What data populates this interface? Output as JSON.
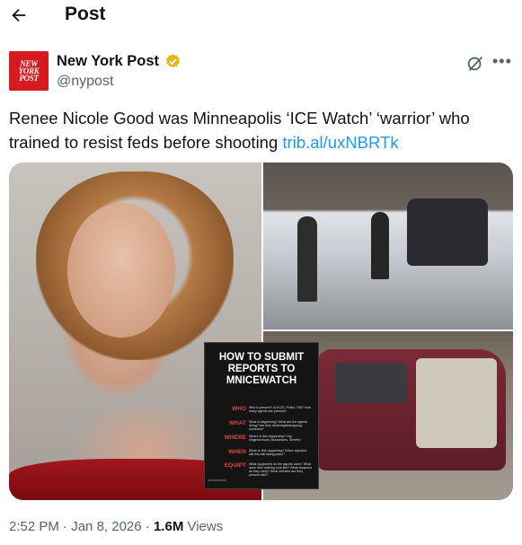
{
  "header": {
    "title": "Post"
  },
  "author": {
    "display_name": "New York Post",
    "handle": "@nypost",
    "avatar_lines": [
      "NEW",
      "YORK",
      "POST"
    ]
  },
  "post": {
    "text": "Renee Nicole Good was Minneapolis ‘ICE Watch’ ‘warrior’ who trained to resist feds before shooting",
    "link": "trib.al/uxNBRTk"
  },
  "media": {
    "card": {
      "title_lines": [
        "HOW TO SUBMIT",
        "REPORTS TO",
        "MNICEWATCH"
      ],
      "rows": [
        {
          "key": "WHO",
          "text": "Who is present? Is it ICE, Police, FBI? How many agents are present?"
        },
        {
          "key": "WHAT",
          "text": "What is happening? What are the agents doing? Are they detaining/kidnapping someone?"
        },
        {
          "key": "WHERE",
          "text": "Where is this happening? City, Neighborhood, Businesses, Streets?"
        },
        {
          "key": "WHEN",
          "text": "When is this happening? When reported, still this still taking place?"
        },
        {
          "key": "EQUIPT",
          "text": "What equipment do the agents have? What does their clothing look like? What weapons do they carry? What vehicles are they present with?"
        }
      ],
      "footer": "mnicewatch"
    }
  },
  "meta": {
    "time": "2:52 PM",
    "sep1": " · ",
    "date": "Jan 8, 2026",
    "sep2": " · ",
    "views_count": "1.6M",
    "views_label": " Views"
  },
  "colors": {
    "link": "#1d9bf0",
    "avatar_bg": "#d71920",
    "verified": "#e2b719"
  },
  "icons": {
    "back": "back-arrow-icon",
    "verified": "verified-badge-icon",
    "grok": "grok-icon",
    "more": "more-icon"
  }
}
